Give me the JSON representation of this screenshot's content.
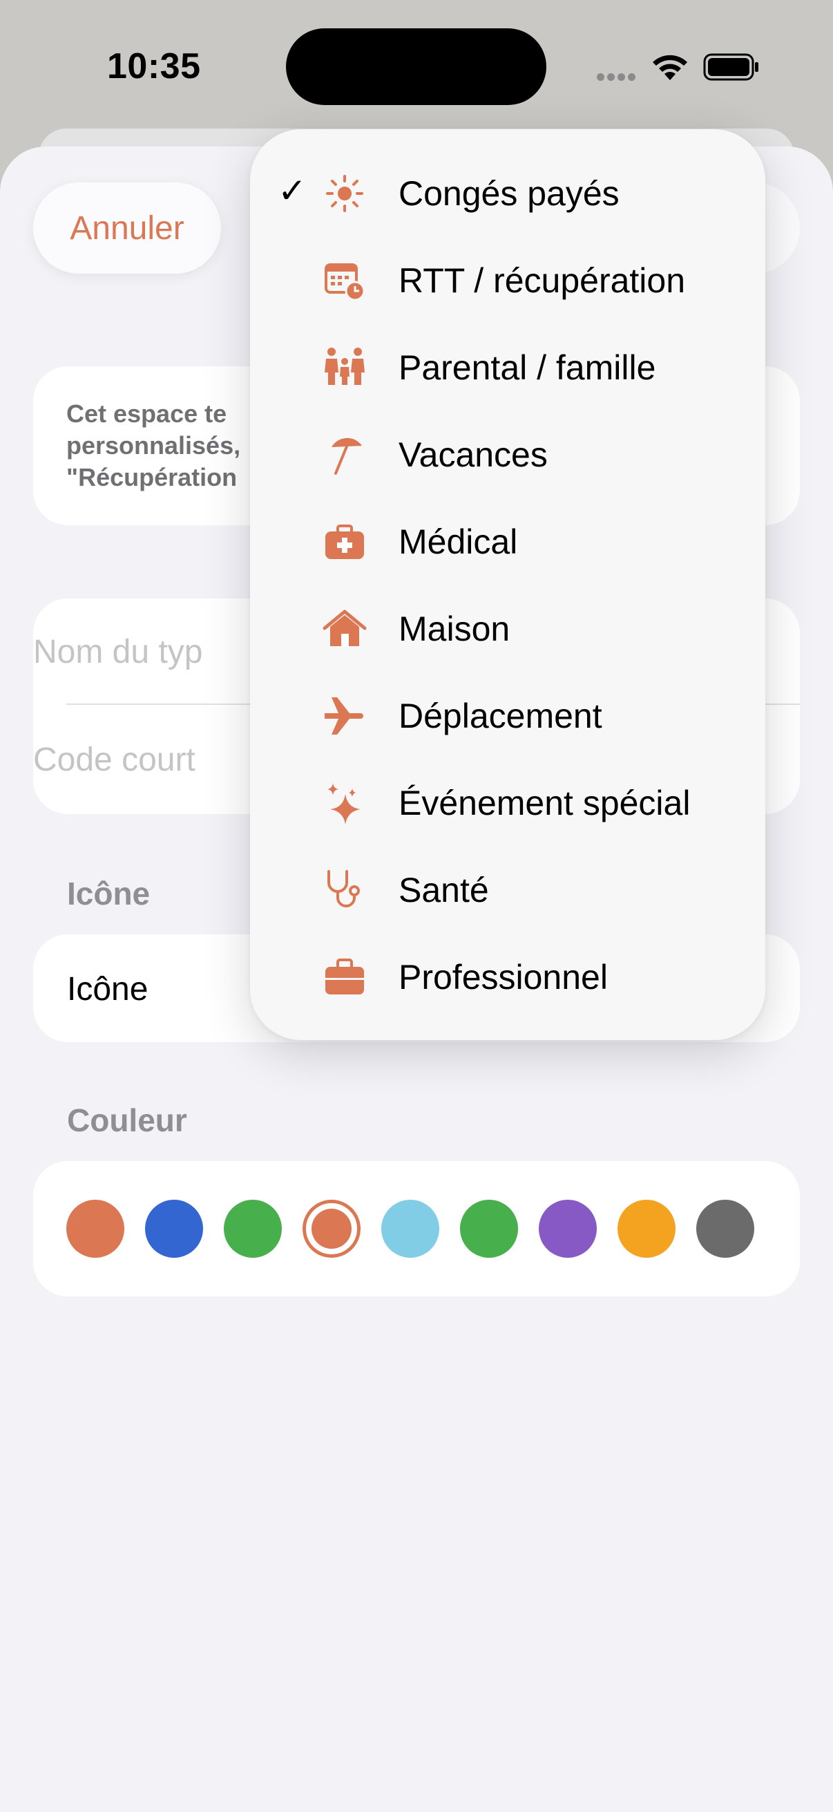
{
  "status_bar": {
    "time": "10:35"
  },
  "nav": {
    "cancel_label": "Annuler"
  },
  "info": {
    "text_line1": "Cet espace te",
    "text_line2": "personnalisés,",
    "text_line3": "\"Récupération"
  },
  "form": {
    "name_placeholder": "Nom du typ",
    "code_placeholder": "Code court"
  },
  "icon_section": {
    "header": "Icône",
    "row_label": "Icône"
  },
  "color_section": {
    "header": "Couleur",
    "swatches": [
      "#dc7753",
      "#3366d1",
      "#47af4c",
      "#dc7753",
      "#82cde6",
      "#47af4c",
      "#8759c4",
      "#f4a321",
      "#6b6b6b"
    ],
    "selected_index": 3
  },
  "menu": {
    "accent": "#dc7753",
    "items": [
      {
        "label": "Congés payés",
        "icon": "sun-icon",
        "checked": true
      },
      {
        "label": "RTT / récupération",
        "icon": "calendar-clock-icon",
        "checked": false
      },
      {
        "label": "Parental / famille",
        "icon": "family-icon",
        "checked": false
      },
      {
        "label": "Vacances",
        "icon": "beach-umbrella-icon",
        "checked": false
      },
      {
        "label": "Médical",
        "icon": "medical-kit-icon",
        "checked": false
      },
      {
        "label": "Maison",
        "icon": "house-icon",
        "checked": false
      },
      {
        "label": "Déplacement",
        "icon": "airplane-icon",
        "checked": false
      },
      {
        "label": "Événement spécial",
        "icon": "sparkles-icon",
        "checked": false
      },
      {
        "label": "Santé",
        "icon": "stethoscope-icon",
        "checked": false
      },
      {
        "label": "Professionnel",
        "icon": "briefcase-icon",
        "checked": false
      }
    ]
  }
}
